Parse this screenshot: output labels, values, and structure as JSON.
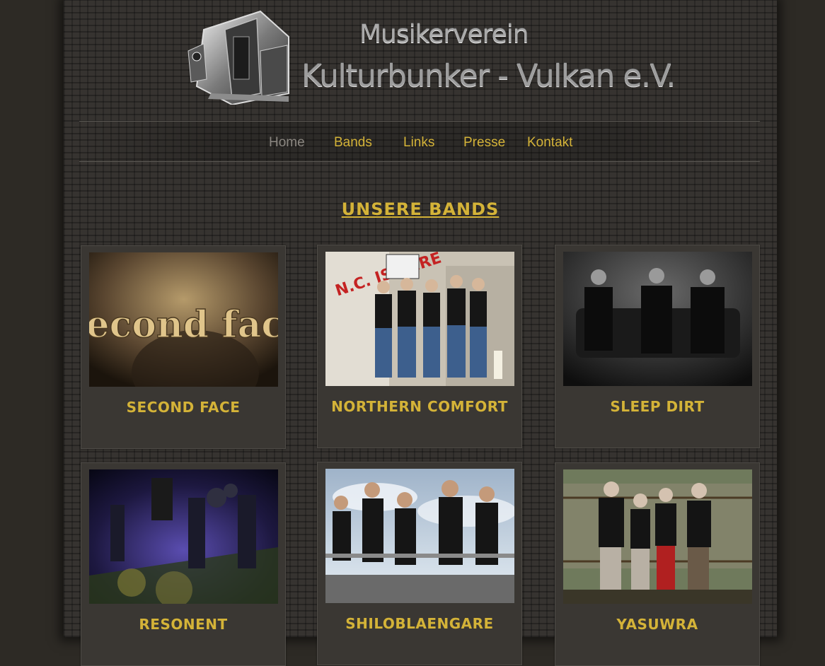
{
  "header": {
    "title_line1": "Musikerverein",
    "title_line2": "Kulturbunker - Vulkan e.V.",
    "logo_icon": "bunker-building-logo"
  },
  "nav": {
    "items": [
      {
        "label": "Home",
        "active": true
      },
      {
        "label": "Bands",
        "active": false
      },
      {
        "label": "Links",
        "active": false
      },
      {
        "label": "Presse",
        "active": false
      },
      {
        "label": "Kontakt",
        "active": false
      }
    ]
  },
  "main": {
    "section_title": "UNSERE BANDS",
    "bands": [
      {
        "name": "SECOND FACE",
        "photo_text": "Second face"
      },
      {
        "name": "NORTHERN COMFORT",
        "photo_text": "N.C. IS HERE"
      },
      {
        "name": "SLEEP DIRT"
      },
      {
        "name": "RESONENT"
      },
      {
        "name": "SHILOBLAENGARE"
      },
      {
        "name": "YASUWRA"
      }
    ]
  },
  "colors": {
    "accent": "#d4b338",
    "background": "#363330",
    "nav_inactive": "#8a8680"
  }
}
